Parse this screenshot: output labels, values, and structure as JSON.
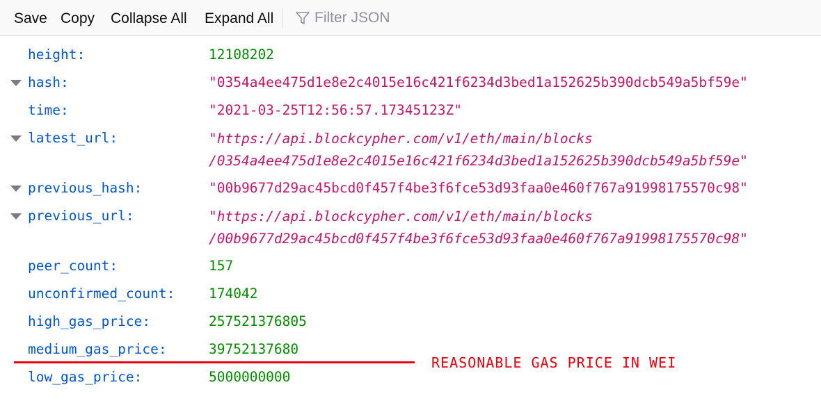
{
  "toolbar": {
    "save_label": "Save",
    "copy_label": "Copy",
    "collapse_all_label": "Collapse All",
    "expand_all_label": "Expand All",
    "filter_placeholder": "Filter JSON"
  },
  "json": {
    "height": {
      "key": "height:",
      "value": "12108202"
    },
    "hash": {
      "key": "hash:",
      "value": "\"0354a4ee475d1e8e2c4015e16c421f6234d3bed1a152625b390dcb549a5bf59e\""
    },
    "time": {
      "key": "time:",
      "value": "\"2021-03-25T12:56:57.17345123Z\""
    },
    "latest_url": {
      "key": "latest_url:",
      "value_line1": "\"https://api.blockcypher.com/v1/eth/main/blocks",
      "value_line2": "/0354a4ee475d1e8e2c4015e16c421f6234d3bed1a152625b390dcb549a5bf59e\""
    },
    "previous_hash": {
      "key": "previous_hash:",
      "value": "\"00b9677d29ac45bcd0f457f4be3f6fce53d93faa0e460f767a91998175570c98\""
    },
    "previous_url": {
      "key": "previous_url:",
      "value_line1": "\"https://api.blockcypher.com/v1/eth/main/blocks",
      "value_line2": "/00b9677d29ac45bcd0f457f4be3f6fce53d93faa0e460f767a91998175570c98\""
    },
    "peer_count": {
      "key": "peer_count:",
      "value": "157"
    },
    "unconfirmed_count": {
      "key": "unconfirmed_count:",
      "value": "174042"
    },
    "high_gas_price": {
      "key": "high_gas_price:",
      "value": "257521376805"
    },
    "medium_gas_price": {
      "key": "medium_gas_price:",
      "value": "39752137680"
    },
    "low_gas_price": {
      "key": "low_gas_price:",
      "value": "5000000000"
    }
  },
  "annotation": {
    "text": "REASONABLE GAS PRICE IN WEI",
    "color": "#e8000f"
  },
  "colors": {
    "key": "#0055cc",
    "number": "#058b00",
    "string": "#c2186b"
  }
}
